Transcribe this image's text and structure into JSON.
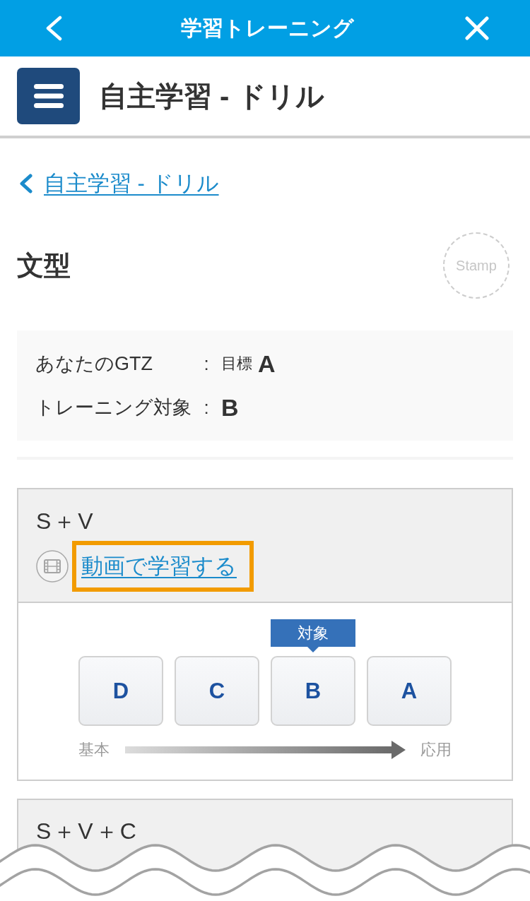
{
  "header": {
    "title": "学習トレーニング"
  },
  "page_header": {
    "title": "自主学習 - ドリル"
  },
  "breadcrumb": {
    "label": "自主学習 - ドリル"
  },
  "section": {
    "title": "文型",
    "stamp": "Stamp"
  },
  "summary": [
    {
      "label": "あなたのGTZ",
      "separator": ":",
      "prefix": "目標",
      "value": "A"
    },
    {
      "label": "トレーニング対象",
      "separator": ":",
      "value": "B"
    }
  ],
  "drills": [
    {
      "title": "S＋V",
      "video_link": "動画で学習する",
      "highlighted": true,
      "levels": [
        {
          "label": "D"
        },
        {
          "label": "C"
        },
        {
          "label": "B",
          "badge": "対象"
        },
        {
          "label": "A"
        }
      ],
      "scale": {
        "start": "基本",
        "end": "応用"
      }
    },
    {
      "title": "S＋V＋C"
    }
  ]
}
